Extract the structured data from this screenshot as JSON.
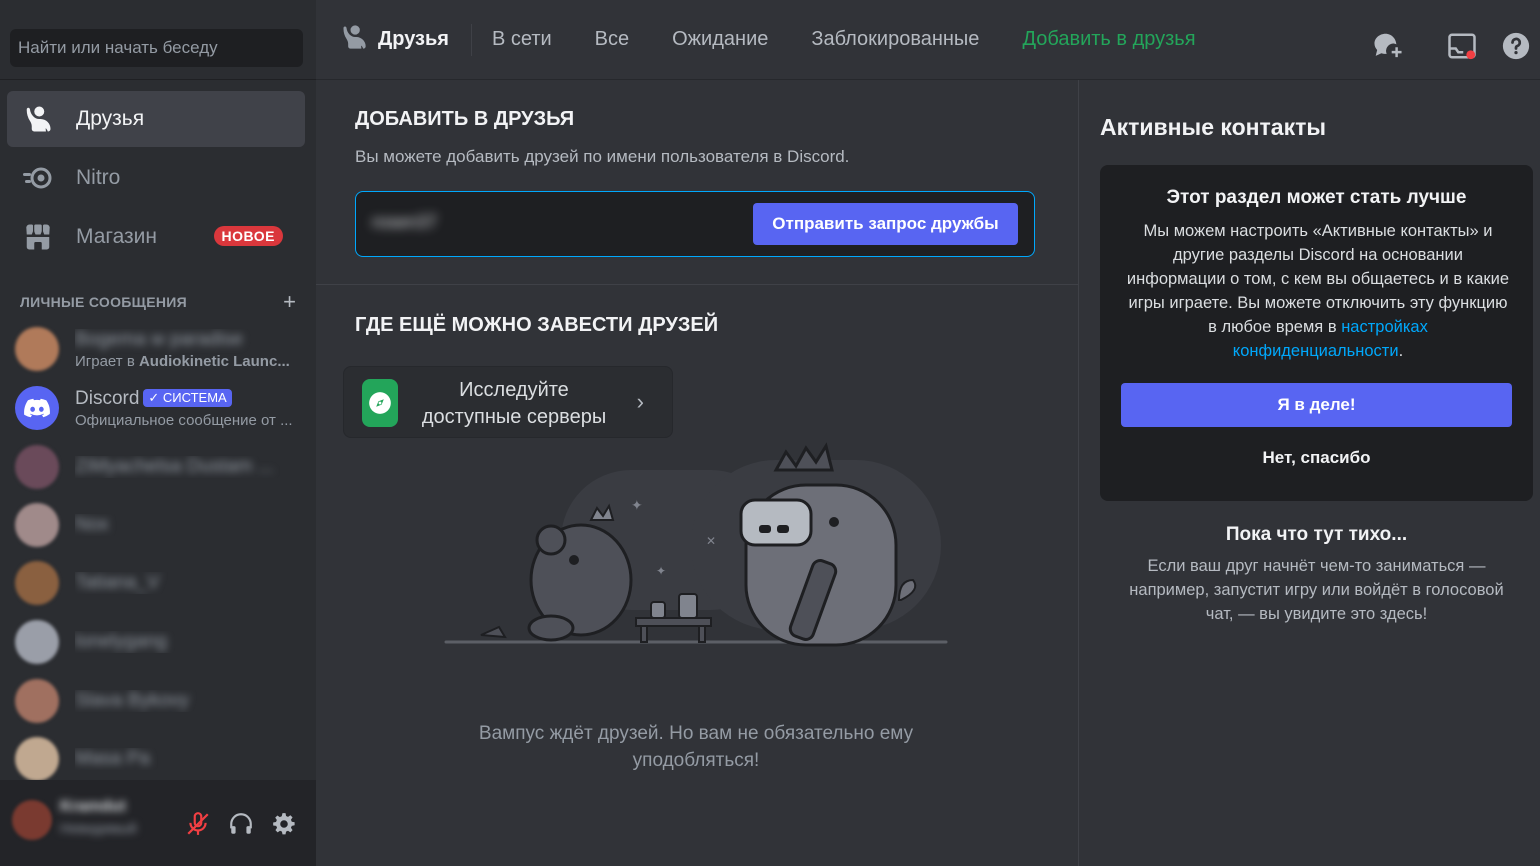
{
  "search": {
    "placeholder": "Найти или начать беседу"
  },
  "nav": {
    "friends": "Друзья",
    "nitro": "Nitro",
    "shop": "Магазин",
    "shop_badge": "НОВОЕ"
  },
  "dms": {
    "header": "ЛИЧНЫЕ СООБЩЕНИЯ",
    "add": "+",
    "items": [
      {
        "name": "Bogema w paradise",
        "sub_prefix": "Играет в ",
        "sub_game": "Audiokinetic Launc...",
        "blurred": true,
        "color": "#b07a5a"
      },
      {
        "name": "Discord",
        "badge": "✓ СИСТЕМА",
        "sub": "Официальное сообщение от ...",
        "blurred": false,
        "color": "#5865f2"
      },
      {
        "name": "ZiMyachelsa Dustam ...",
        "blurred": true,
        "color": "#6a4a5a"
      },
      {
        "name": "Nox",
        "blurred": true,
        "color": "#a08a8a"
      },
      {
        "name": "Tatiana_V",
        "blurred": true,
        "color": "#8a6040"
      },
      {
        "name": "lonelygang",
        "blurred": true,
        "color": "#9a9ea8"
      },
      {
        "name": "Slava Bykovy",
        "blurred": true,
        "color": "#a07060"
      },
      {
        "name": "Masa Pa",
        "blurred": true,
        "color": "#c0a890"
      }
    ]
  },
  "user": {
    "name": "Kramdut",
    "status": "Невидимый"
  },
  "topbar": {
    "title": "Друзья",
    "tabs": [
      "В сети",
      "Все",
      "Ожидание",
      "Заблокированные"
    ],
    "add_tab": "Добавить в друзья"
  },
  "add_friend": {
    "title": "ДОБАВИТЬ В ДРУЗЬЯ",
    "description": "Вы можете добавить друзей по имени пользователя в Discord.",
    "input_value": "rosen37",
    "button": "Отправить запрос дружбы"
  },
  "other_places": {
    "title": "ГДЕ ЕЩЁ МОЖНО ЗАВЕСТИ ДРУЗЕЙ",
    "explore_label": "Исследуйте доступные серверы"
  },
  "empty_state": "Вампус ждёт друзей. Но вам не обязательно ему уподобляться!",
  "active_now": {
    "title": "Активные контакты",
    "promo_title": "Этот раздел может стать лучше",
    "promo_body": "Мы можем настроить «Активные контакты» и другие разделы Discord на основании информации о том, с кем вы общаетесь и в какие игры играете. Вы можете отключить эту функцию в любое время в ",
    "promo_link": "настройках конфиденциальности",
    "promo_end": ".",
    "promo_ok": "Я в деле!",
    "promo_no": "Нет, спасибо",
    "quiet_title": "Пока что тут тихо...",
    "quiet_body": "Если ваш друг начнёт чем-то заниматься — например, запустит игру или войдёт в голосовой чат, — вы увидите это здесь!"
  },
  "colors": {
    "accent": "#5865f2",
    "green": "#23a55a",
    "link": "#00a8fc",
    "danger": "#da373c"
  },
  "icons": [
    "friends-icon",
    "nitro-icon",
    "shop-icon",
    "discord-logo-icon",
    "mute-mic-icon",
    "headphones-icon",
    "settings-gear-icon",
    "new-group-dm-icon",
    "inbox-icon",
    "help-icon",
    "compass-icon",
    "chevron-right-icon"
  ]
}
